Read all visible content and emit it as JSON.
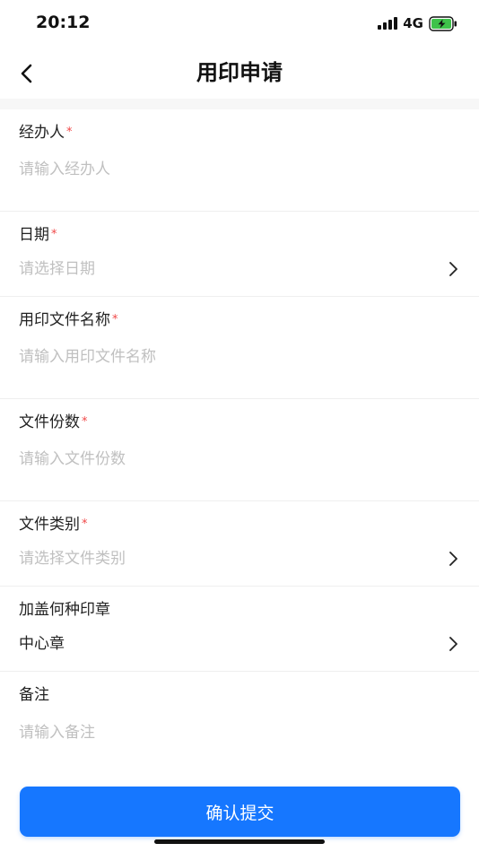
{
  "status_bar": {
    "time": "20:12",
    "network": "4G",
    "icons": [
      "signal-icon",
      "battery-charging-icon"
    ],
    "battery_color": "#3ec24a"
  },
  "nav": {
    "title": "用印申请",
    "back_icon": "chevron-left-icon"
  },
  "form": {
    "handler": {
      "label": "经办人",
      "required_mark": "*",
      "placeholder": "请输入经办人"
    },
    "date": {
      "label": "日期",
      "required_mark": "*",
      "placeholder": "请选择日期"
    },
    "file_name": {
      "label": "用印文件名称",
      "required_mark": "*",
      "placeholder": "请输入用印文件名称"
    },
    "file_copies": {
      "label": "文件份数",
      "required_mark": "*",
      "placeholder": "请输入文件份数"
    },
    "file_category": {
      "label": "文件类别",
      "required_mark": "*",
      "placeholder": "请选择文件类别"
    },
    "seal_type": {
      "label": "加盖何种印章",
      "value": "中心章"
    },
    "remark": {
      "label": "备注",
      "placeholder": "请输入备注"
    }
  },
  "submit": {
    "label": "确认提交"
  },
  "colors": {
    "accent": "#1677ff",
    "required": "#f04848",
    "placeholder": "#c0c0c0"
  }
}
